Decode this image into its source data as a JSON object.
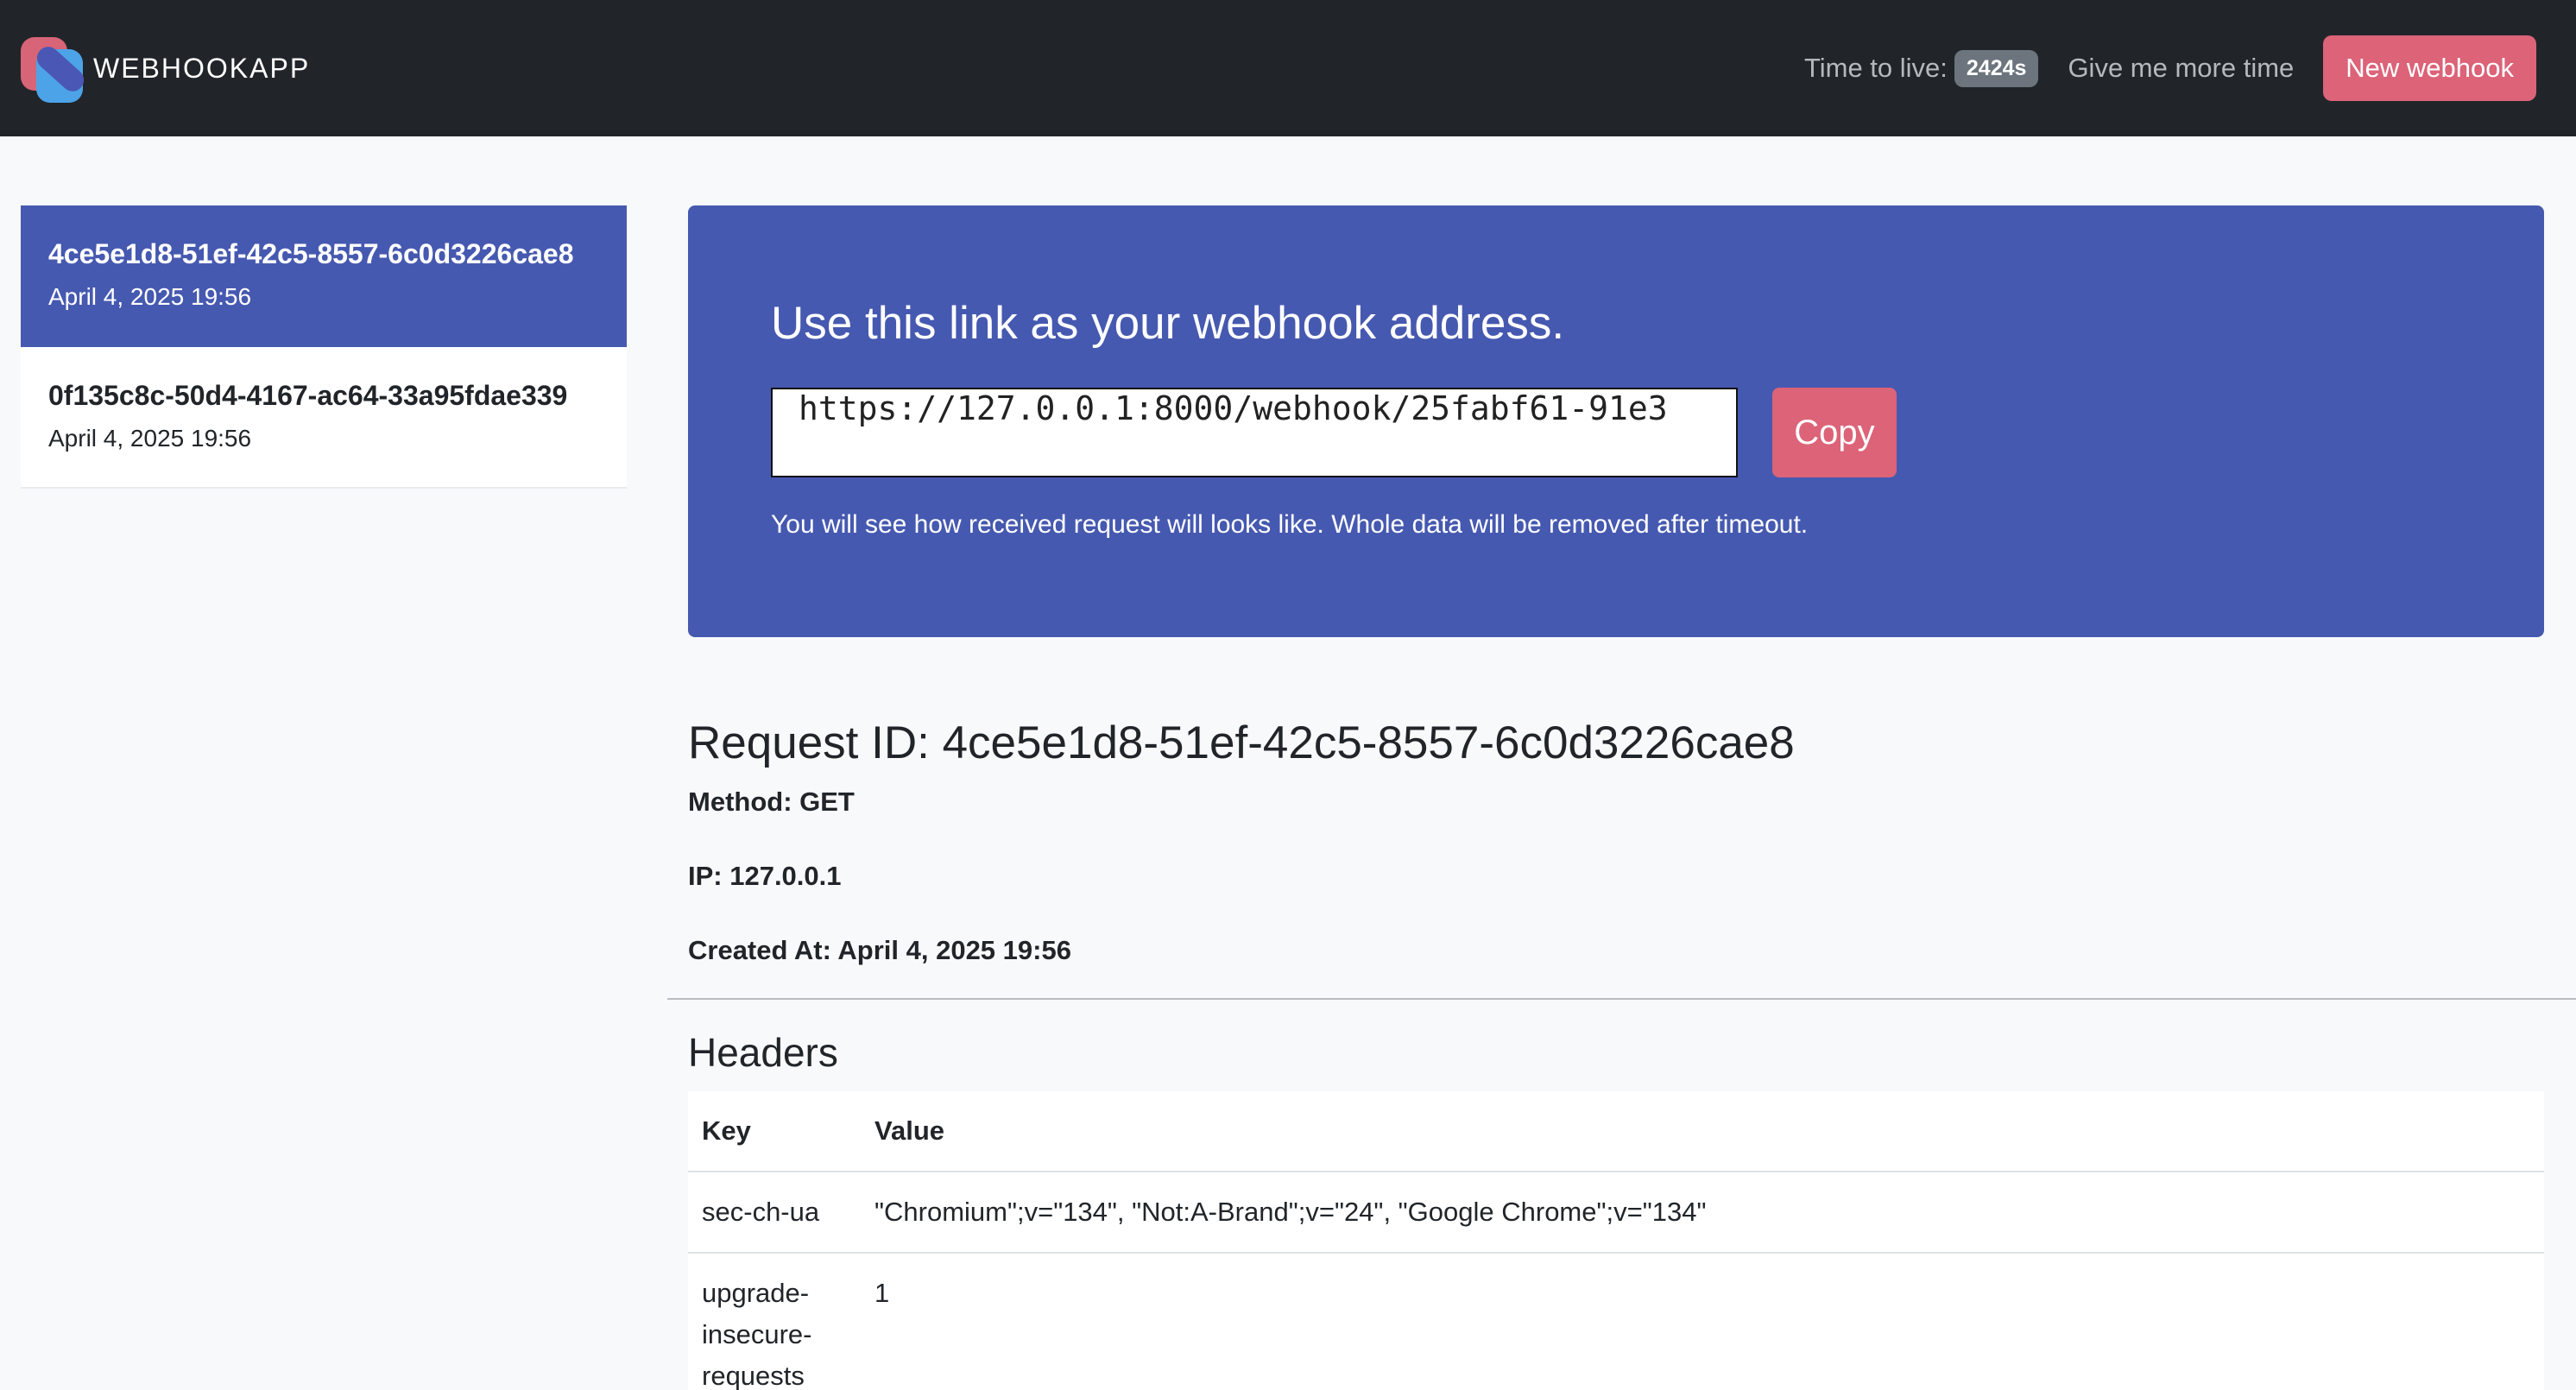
{
  "brand": {
    "name": "WEBHOOKAPP",
    "logo_icon": "webhookapp-logo-icon"
  },
  "navbar": {
    "ttl_label": "Time to live:",
    "ttl_value": "2424s",
    "more_time_label": "Give me more time",
    "new_webhook_label": "New webhook"
  },
  "requests": [
    {
      "id": "4ce5e1d8-51ef-42c5-8557-6c0d3226cae8",
      "date": "April 4, 2025 19:56",
      "active": true
    },
    {
      "id": "0f135c8c-50d4-4167-ac64-33a95fdae339",
      "date": "April 4, 2025 19:56",
      "active": false
    }
  ],
  "hero": {
    "title": "Use this link as your webhook address.",
    "url": "https://127.0.0.1:8000/webhook/25fabf61-91e3",
    "copy_label": "Copy",
    "note": "You will see how received request will looks like. Whole data will be removed after timeout."
  },
  "detail": {
    "title": "Request ID: 4ce5e1d8-51ef-42c5-8557-6c0d3226cae8",
    "method": "Method: GET",
    "ip": "IP: 127.0.0.1",
    "created": "Created At: April 4, 2025 19:56"
  },
  "headers": {
    "title": "Headers",
    "col_key": "Key",
    "col_value": "Value",
    "rows": [
      {
        "key": "sec-ch-ua",
        "value": "\"Chromium\";v=\"134\", \"Not:A-Brand\";v=\"24\", \"Google Chrome\";v=\"134\""
      },
      {
        "key": "upgrade-insecure-requests",
        "value": "1"
      }
    ]
  },
  "colors": {
    "navbar": "#212529",
    "primary": "#4659b0",
    "accent": "#dc6378",
    "badge": "#6c757d"
  }
}
